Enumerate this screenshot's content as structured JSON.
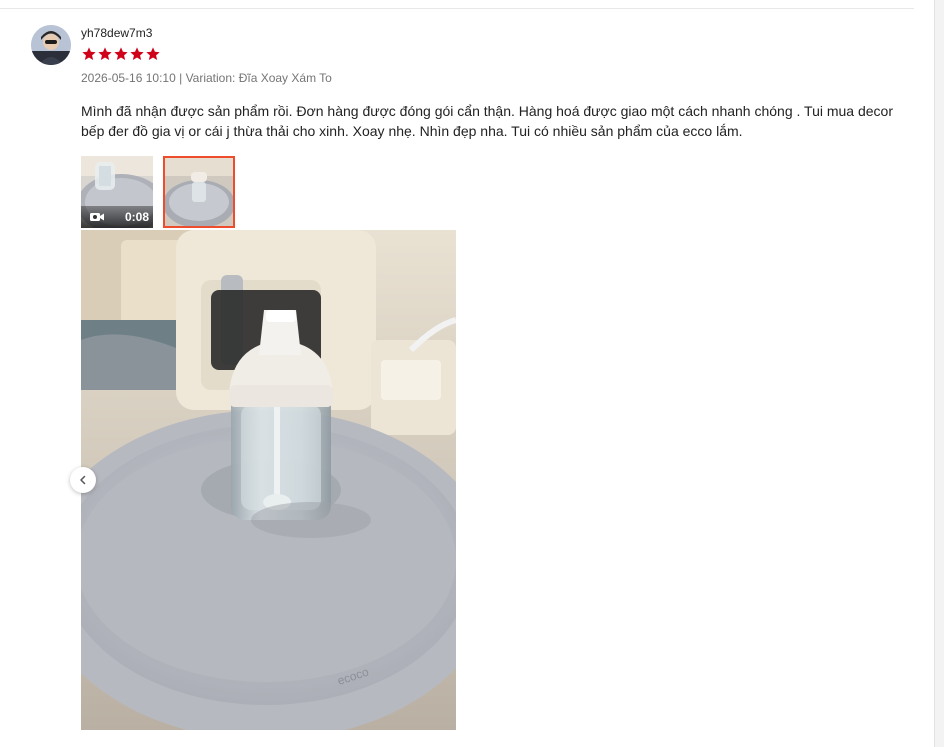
{
  "review": {
    "username": "yh78dew7m3",
    "rating": 5,
    "rating_max": 5,
    "datetime": "2026-05-16 10:10",
    "separator": "|",
    "variation": "Variation: Đĩa Xoay Xám To",
    "comment": "Mình đã nhận được sản phẩm rồi. Đơn hàng được đóng gói cẩn thận. Hàng hoá được giao một cách nhanh chóng .  Tui mua decor bếp đer đồ gia vị or cái j thừa thải cho xinh. Xoay nhẹ. Nhìn đẹp nha. Tui có nhiều sản phẩm của ecco lắm."
  },
  "media": {
    "thumbnails": [
      {
        "type": "video",
        "duration": "0:08",
        "selected": false
      },
      {
        "type": "image",
        "selected": true
      }
    ],
    "main_image_brand": "ecoco"
  },
  "colors": {
    "star": "#d0011b",
    "selected_border": "#ee4d2d",
    "meta_text": "#757575"
  },
  "icons": {
    "star": "star-icon",
    "video": "video-camera-icon",
    "prev": "chevron-left-icon"
  }
}
